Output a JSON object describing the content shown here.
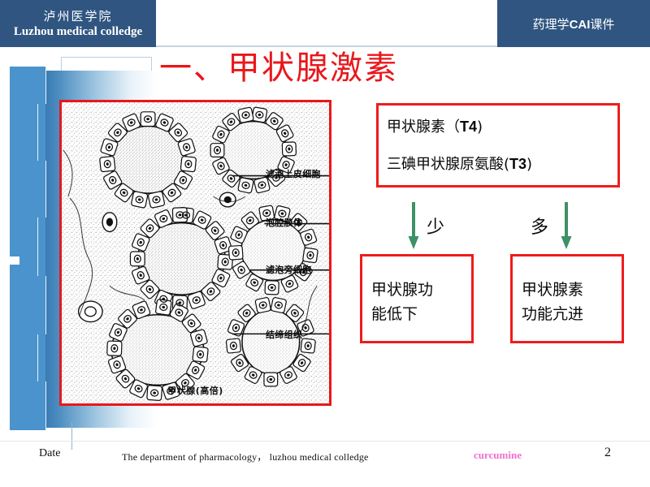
{
  "header": {
    "institution_cn": "泸州医学院",
    "institution_en": "Luzhou medical colledge",
    "course_badge_pre": "药理学",
    "course_badge_mid": "CAI",
    "course_badge_post": "课件",
    "band_color": "#2f5580"
  },
  "title": {
    "text": "一、甲状腺激素",
    "color": "#e8171b"
  },
  "figure": {
    "caption": "甲状腺(高倍)",
    "frame_color": "#ee1c1c",
    "labels": [
      {
        "text": "滤泡上皮细胞"
      },
      {
        "text": "泡腔胶体"
      },
      {
        "text": "滤泡旁细胞"
      },
      {
        "text": "结缔组织"
      }
    ]
  },
  "hormone_box": {
    "line1_cn": "甲状腺素（",
    "line1_code": "T4",
    "line1_tail": ")",
    "line2_cn": "三碘甲状腺原氨酸(",
    "line2_code": "T3",
    "line2_tail": ")",
    "border_color": "#ee1c1c"
  },
  "arrows": {
    "color": "#3d9166",
    "left_label": "少",
    "right_label": "多"
  },
  "outcome_boxes": [
    {
      "name": "hypothyroid",
      "text": "甲状腺功\n能低下"
    },
    {
      "name": "hyperthyroid",
      "text": "甲状腺素\n功能亢进"
    }
  ],
  "footer": {
    "date_label": "Date",
    "center_text": "The   department   of   pharmacology，  luzhou   medical   colledge",
    "author": "curcumine",
    "author_color": "#f06fd0",
    "page_number": "2"
  }
}
